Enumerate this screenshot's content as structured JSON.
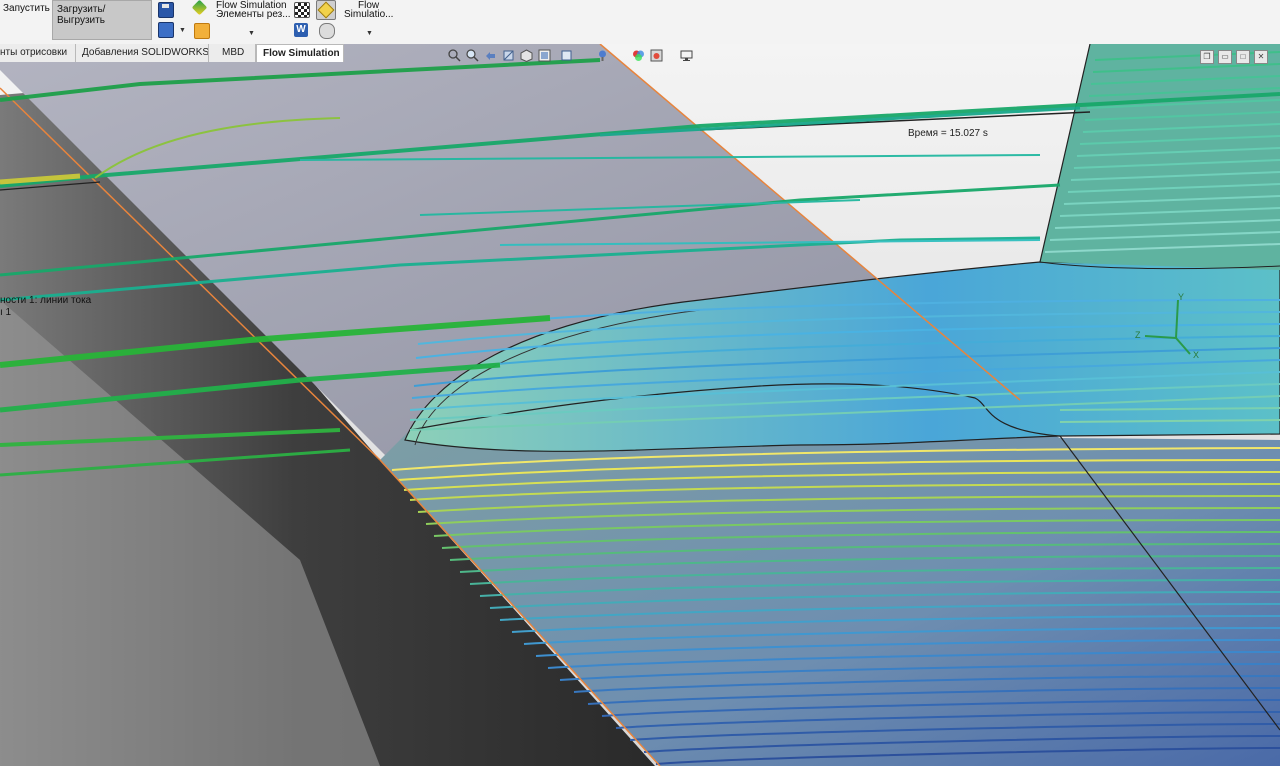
{
  "ribbon": {
    "run_label": "Запустить",
    "load_label": "Загрузить/Выгрузить",
    "fs1_line1": "Flow Simulation",
    "fs1_line2": "Элементы рез...",
    "fs2_line1": "Flow",
    "fs2_line2": "Simulatio..."
  },
  "tabs": [
    {
      "label": "нты отрисовки"
    },
    {
      "label": "Добавления SOLIDWORKS"
    },
    {
      "label": "MBD"
    },
    {
      "label": "Flow Simulation"
    }
  ],
  "viewport": {
    "time_label": "Время = 15.027 s",
    "tree_label_1": "ности 1: линии тока",
    "tree_label_2": "ı 1",
    "triad": {
      "x": "X",
      "y": "Y",
      "z": "Z"
    }
  },
  "icons": {
    "save": "save-icon",
    "refresh": "refresh-icon",
    "flow-sim": "flow-simulation-icon",
    "results": "results-icon",
    "checkered-flag": "checkered-flag-icon",
    "word-report": "word-report-icon",
    "cube": "cube-icon",
    "component": "component-icon"
  },
  "colors": {
    "ribbon_bg": "#f3f3f3",
    "active_tab_bg": "#ffffff",
    "body_fill": "#9a9cab",
    "accent_orange": "#e8843c"
  }
}
